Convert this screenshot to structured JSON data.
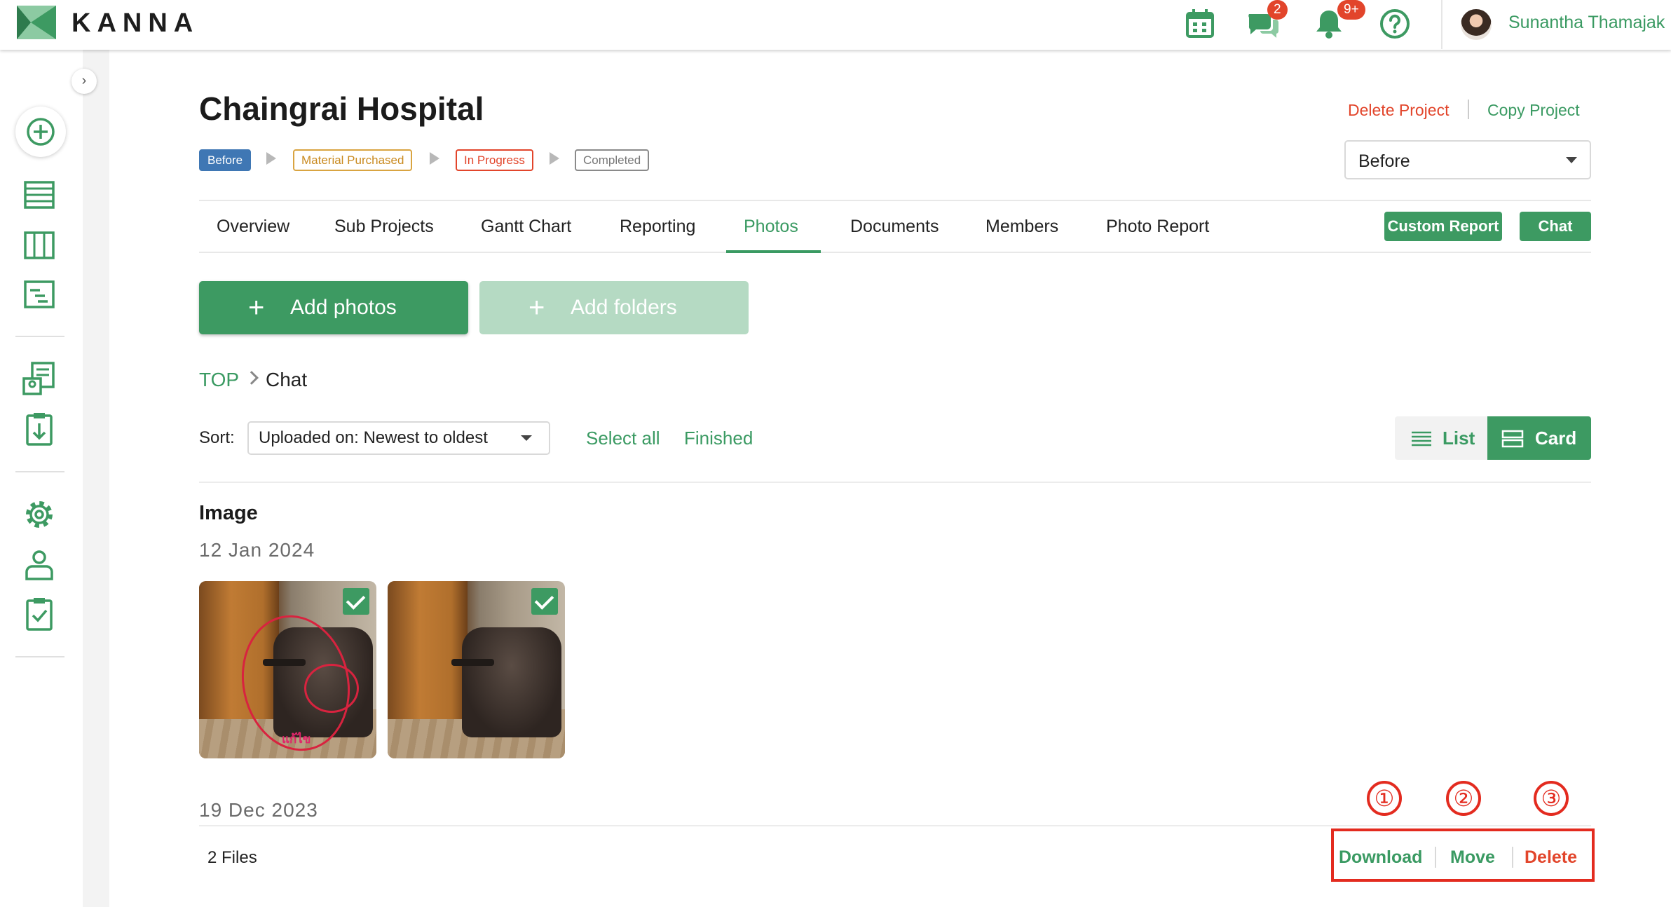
{
  "header": {
    "brand": "KANNA",
    "chat_badge": "2",
    "notification_badge": "9+",
    "user_name": "Sunantha Thamajak"
  },
  "project": {
    "title": "Chaingrai Hospital",
    "delete_label": "Delete Project",
    "copy_label": "Copy Project",
    "statuses": [
      "Before",
      "Material Purchased",
      "In Progress",
      "Completed"
    ],
    "status_value": "Before"
  },
  "tabs": [
    "Overview",
    "Sub Projects",
    "Gantt Chart",
    "Reporting",
    "Photos",
    "Documents",
    "Members",
    "Photo Report"
  ],
  "active_tab": "Photos",
  "buttons": {
    "custom_report": "Custom Report",
    "chat": "Chat",
    "add_photos": "Add photos",
    "add_folders": "Add folders"
  },
  "breadcrumb": {
    "root": "TOP",
    "current": "Chat"
  },
  "sort": {
    "label": "Sort:",
    "value": "Uploaded on: Newest to oldest",
    "select_all": "Select all",
    "finished": "Finished"
  },
  "view": {
    "list": "List",
    "card": "Card",
    "selected": "Card"
  },
  "gallery": {
    "section": "Image",
    "groups": [
      {
        "date": "12 Jan 2024",
        "photo_count": 2
      },
      {
        "date": "19 Dec 2023"
      }
    ],
    "photo_note": "แก้ไข"
  },
  "footer": {
    "files": "2 Files",
    "download": "Download",
    "move": "Move",
    "delete": "Delete",
    "markers": [
      "①",
      "②",
      "③"
    ]
  },
  "colors": {
    "brand_green": "#3d9a62",
    "danger": "#e2452b",
    "highlight_red": "#e32b1f",
    "disabled_green": "#b5dac3"
  }
}
